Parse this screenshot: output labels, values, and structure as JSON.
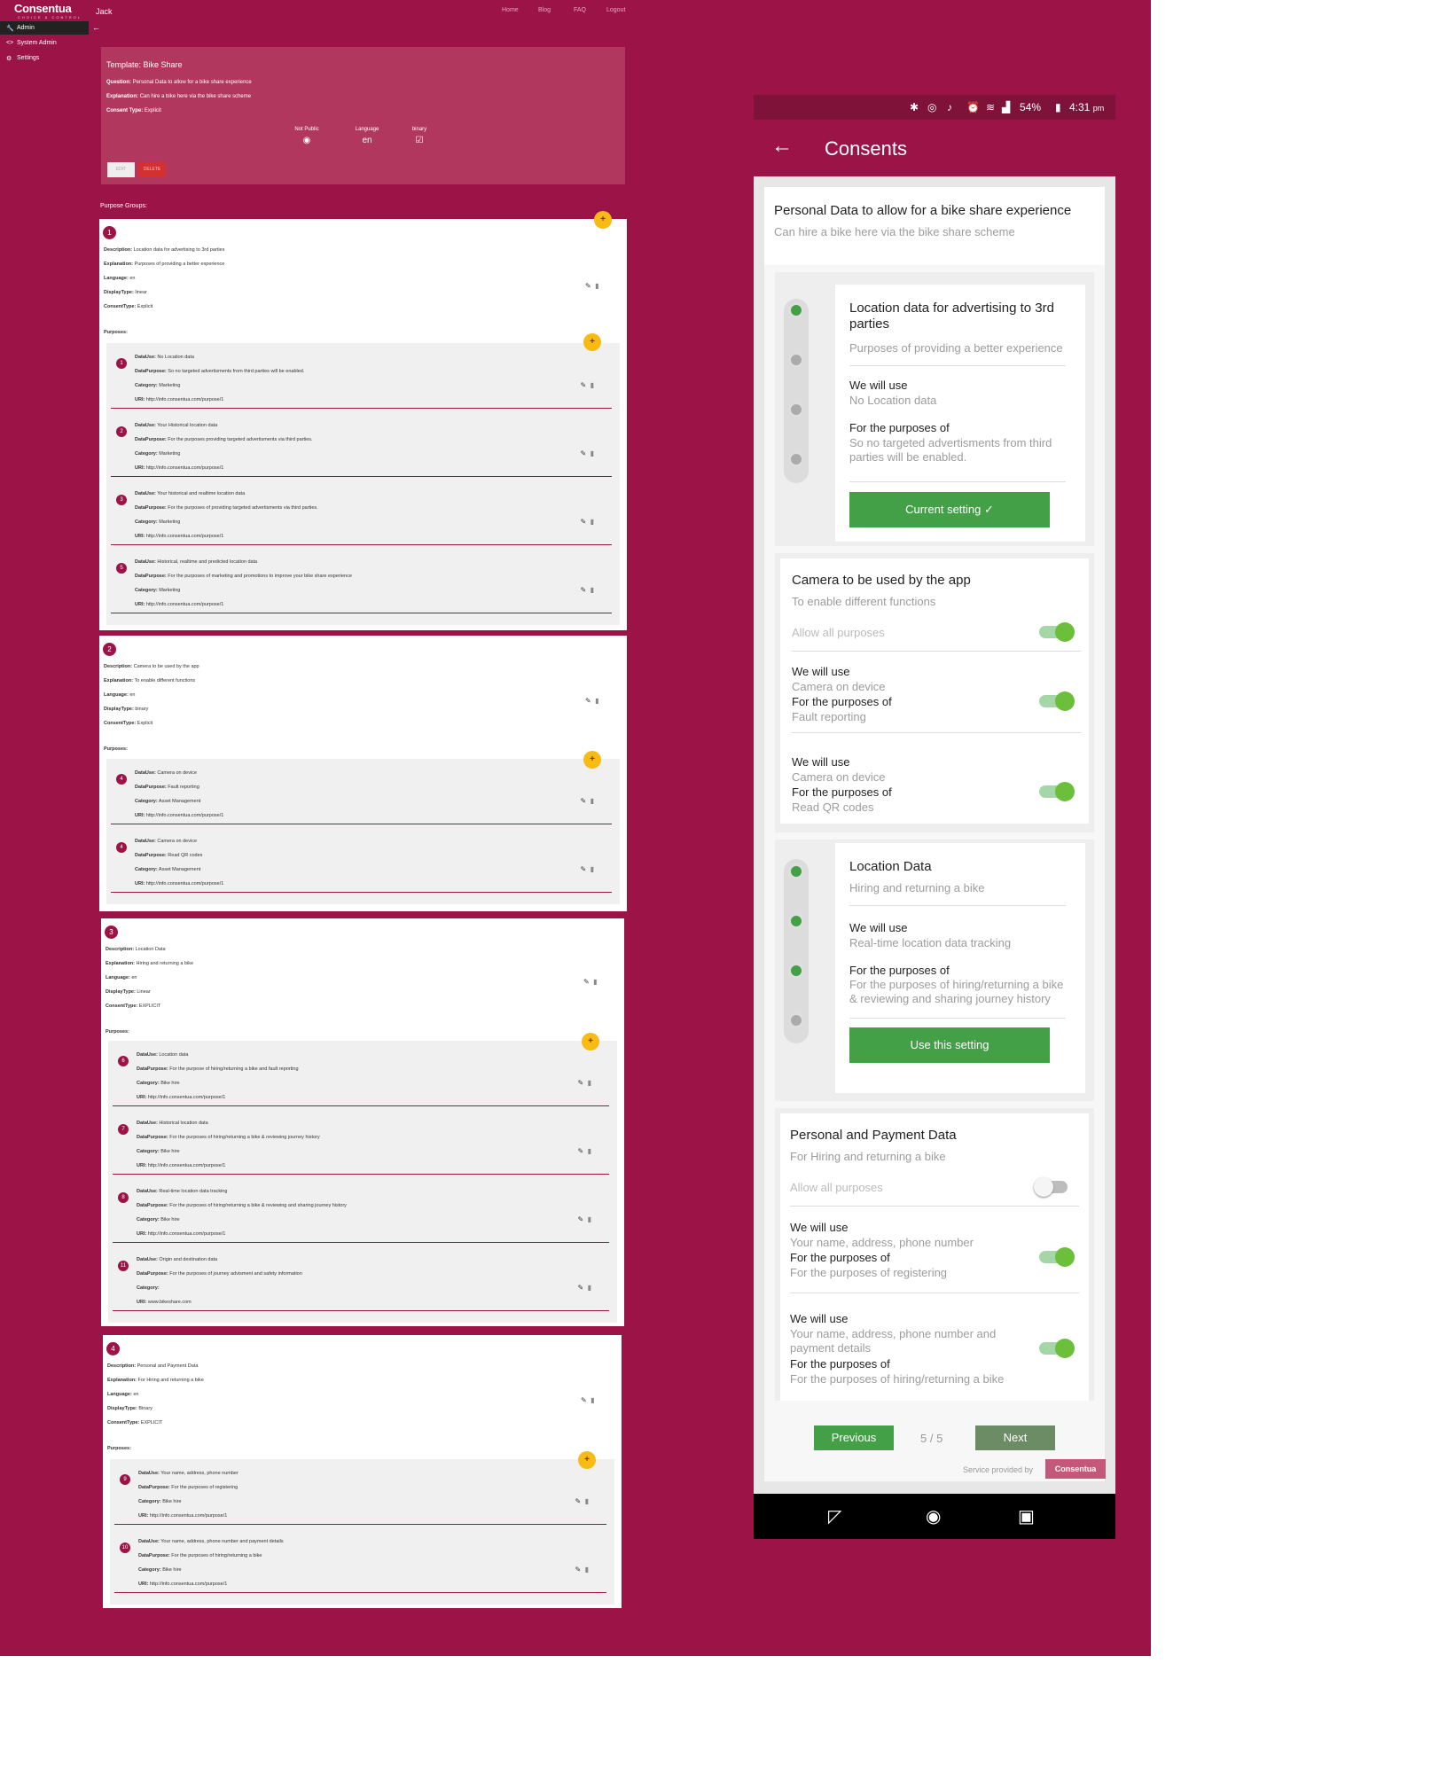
{
  "sidebar": {
    "logo": "Consentua",
    "logo_sub": "CHOICE & CONTROL",
    "items": [
      {
        "label": "Admin",
        "icon": "wrench-icon"
      },
      {
        "label": "System Admin",
        "icon": "code-icon"
      },
      {
        "label": "Settings",
        "icon": "gear-icon"
      }
    ]
  },
  "topbar": {
    "user": "Jack",
    "back": "←",
    "nav": [
      "Home",
      "Blog",
      "FAQ",
      "Logout"
    ]
  },
  "template": {
    "title": "Template: Bike Share",
    "question_label": "Question:",
    "question": "Personal Data to allow for a bike share experience",
    "explanation_label": "Explanation:",
    "explanation": "Can hire a bike here via the bike share scheme",
    "consent_type_label": "Consent Type:",
    "consent_type": "Explicit",
    "not_public_label": "Not Public",
    "language_label": "Language",
    "language": "en",
    "binary_label": "binary",
    "edit_label": "EDIT",
    "delete_label": "DELETE"
  },
  "purpose_groups_label": "Purpose Groups:",
  "labels": {
    "description": "Description:",
    "explanation": "Explanation:",
    "language": "Language:",
    "display_type": "DisplayType:",
    "consent_type": "ConsentType:",
    "purposes": "Purposes:",
    "data_use": "DataUse:",
    "data_purpose": "DataPurpose:",
    "category": "Category:",
    "uri": "URI:"
  },
  "groups": [
    {
      "num": "1",
      "description": "Location data for advertising to 3rd parties",
      "explanation": "Purposes of providing a better experience",
      "language": "en",
      "display_type": "linear",
      "consent_type": "Explicit",
      "purposes": [
        {
          "num": "1",
          "data_use": "No Location data",
          "data_purpose": "So no targeted advertisments from third parties will be enabled.",
          "category": "Marketing",
          "uri": "http://info.consentua.com/purpose/1"
        },
        {
          "num": "2",
          "data_use": "Your Historical location data",
          "data_purpose": "For the purposes providing targeted advertisments via third parties.",
          "category": "Marketing",
          "uri": "http://info.consentua.com/purpose/1"
        },
        {
          "num": "3",
          "data_use": "Your historical and realtime location data",
          "data_purpose": "For the purposes of providing targeted advertisments via third parties.",
          "category": "Marketing",
          "uri": "http://info.consentua.com/purpose/1"
        },
        {
          "num": "5",
          "data_use": "Historical, realtime and predicted location data",
          "data_purpose": "For the purposes of marketing and promotions to improve your bike share experience",
          "category": "Marketing",
          "uri": "http://info.consentua.com/purpose/1"
        }
      ]
    },
    {
      "num": "2",
      "description": "Camera to be used by the app",
      "explanation": "To enable different functions",
      "language": "en",
      "display_type": "binary",
      "consent_type": "Explicit",
      "purposes": [
        {
          "num": "4",
          "data_use": "Camera on device",
          "data_purpose": "Fault reporting",
          "category": "Asset Management",
          "uri": "http://info.consentua.com/purpose/1"
        },
        {
          "num": "4",
          "data_use": "Camera on device",
          "data_purpose": "Read QR codes",
          "category": "Asset Management",
          "uri": "http://info.consentua.com/purpose/1"
        }
      ]
    },
    {
      "num": "3",
      "description": "Location Data",
      "explanation": "Hiring and returning a bike",
      "language": "en",
      "display_type": "Linear",
      "consent_type": "EXPLICIT",
      "purposes": [
        {
          "num": "6",
          "data_use": "Location data",
          "data_purpose": "For the purpose of hiring/returning a bike and fault reporting",
          "category": "Bike hire",
          "uri": "http://info.consentua.com/purpose/1"
        },
        {
          "num": "7",
          "data_use": "Historical location data",
          "data_purpose": "For the purposes of hiring/returning a bike & reviewing journey history",
          "category": "Bike hire",
          "uri": "http://info.consentua.com/purpose/1"
        },
        {
          "num": "8",
          "data_use": "Real-time location data tracking",
          "data_purpose": "For the purposes of hiring/returning a bike & reviewing and sharing journey history",
          "category": "Bike hire",
          "uri": "http://info.consentua.com/purpose/1"
        },
        {
          "num": "11",
          "data_use": "Origin and destination data",
          "data_purpose": "For the purposes of journey advisment and safety information",
          "category": "",
          "uri": "www.bikeshare.com"
        }
      ]
    },
    {
      "num": "4",
      "description": "Personal and Payment Data",
      "explanation": "For Hiring and returning a bike",
      "language": "en",
      "display_type": "Binary",
      "consent_type": "EXPLICIT",
      "purposes": [
        {
          "num": "9",
          "data_use": "Your name, address, phone number",
          "data_purpose": "For the purposes of registering",
          "category": "Bike hire",
          "uri": "http://info.consentua.com/purpose/1"
        },
        {
          "num": "10",
          "data_use": "Your name, address, phone number and payment details",
          "data_purpose": "For the purposes of hiring/returning a bike",
          "category": "Bike hire",
          "uri": "http://info.consentua.com/purpose/1"
        }
      ]
    }
  ],
  "phone": {
    "status": {
      "battery": "54%",
      "time": "4:31",
      "ampm": "pm"
    },
    "title": "Consents",
    "question": "Personal Data to allow for a bike share experience",
    "explanation": "Can hire a bike here via the bike share scheme",
    "we_will_use": "We will use",
    "for_purposes": "For the purposes of",
    "allow_all": "Allow all purposes",
    "g1": {
      "title": "Location data for advertising to 3rd parties",
      "sub": "Purposes of providing a better experience",
      "use": "No Location data",
      "purpose": "So no targeted advertisments from third parties will be enabled.",
      "button": "Current setting  ✓"
    },
    "g2": {
      "title": "Camera to be used by the app",
      "sub": "To enable different functions",
      "p1_use": "Camera on device",
      "p1_purpose": "Fault reporting",
      "p2_use": "Camera on device",
      "p2_purpose": "Read QR codes"
    },
    "g3": {
      "title": "Location Data",
      "sub": "Hiring and returning a bike",
      "use": "Real-time location data tracking",
      "purpose": "For the purposes of hiring/returning a bike & reviewing and sharing journey history",
      "button": "Use this setting"
    },
    "g4": {
      "title": "Personal and Payment Data",
      "sub": "For Hiring and returning a bike",
      "p1_use": "Your name, address, phone number",
      "p1_purpose": "For the purposes of registering",
      "p2_use": "Your name, address, phone number and payment details",
      "p2_purpose": "For the purposes of hiring/returning a bike"
    },
    "pager": {
      "previous": "Previous",
      "count": "5 / 5",
      "next": "Next"
    },
    "provided_by": "Service provided by",
    "provider_logo": "Consentua"
  },
  "colors": {
    "brand": "#9c1447",
    "green": "#43a047",
    "amber": "#f8bb16"
  }
}
